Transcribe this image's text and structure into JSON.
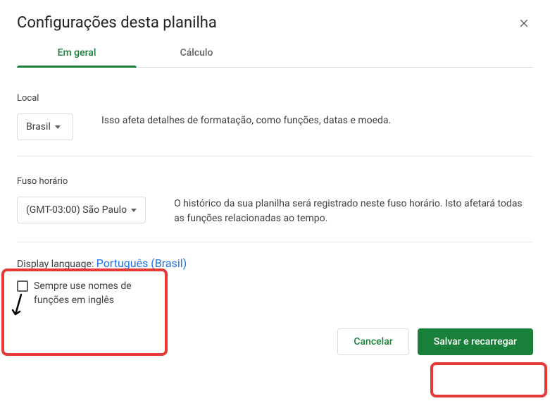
{
  "dialog": {
    "title": "Configurações desta planilha"
  },
  "tabs": {
    "general": "Em geral",
    "calculation": "Cálculo"
  },
  "locale": {
    "label": "Local",
    "value": "Brasil",
    "description": "Isso afeta detalhes de formatação, como funções, datas e moeda."
  },
  "timezone": {
    "label": "Fuso horário",
    "value": "(GMT-03:00) São Paulo",
    "description": "O histórico da sua planilha será registrado neste fuso horário. Isto afetará todas as funções relacionadas ao tempo."
  },
  "display_language": {
    "prefix": "Display language: ",
    "link": "Português (Brasil)",
    "checkbox_label": "Sempre use nomes de funções em inglês"
  },
  "footer": {
    "cancel": "Cancelar",
    "save": "Salvar e recarregar"
  }
}
